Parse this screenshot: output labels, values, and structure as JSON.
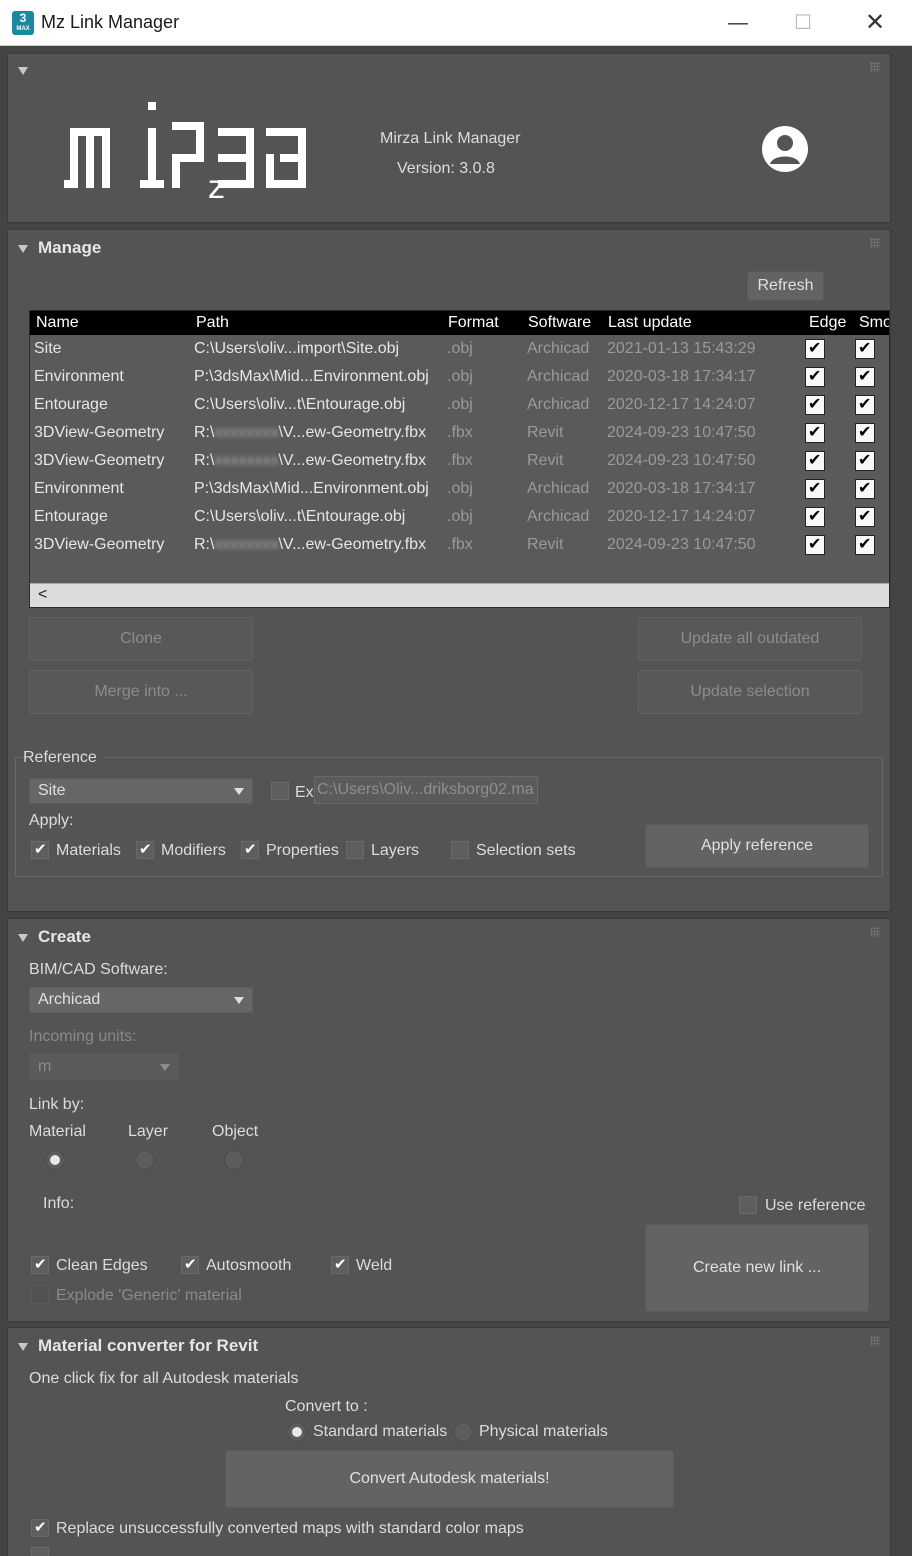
{
  "window": {
    "title": "Mz Link Manager",
    "icon_text": "3",
    "icon_sub": "MAX",
    "min": "—",
    "max": "☐",
    "close": "✕"
  },
  "header": {
    "logo_text": "mirza",
    "app_name": "Mirza Link Manager",
    "version": "Version: 3.0.8"
  },
  "manage": {
    "title": "Manage",
    "refresh": "Refresh",
    "columns": [
      "Name",
      "Path",
      "Format",
      "Software",
      "Last update",
      "Edge",
      "Smo"
    ],
    "rows": [
      {
        "name": "Site",
        "path": "C:\\Users\\oliv...import\\Site.obj",
        "format": ".obj",
        "software": "Archicad",
        "updated": "2021-01-13 15:43:29"
      },
      {
        "name": "Environment",
        "path": "P:\\3dsMax\\Mid...Environment.obj",
        "format": ".obj",
        "software": "Archicad",
        "updated": "2020-03-18 17:34:17"
      },
      {
        "name": "Entourage",
        "path": "C:\\Users\\oliv...t\\Entourage.obj",
        "format": ".obj",
        "software": "Archicad",
        "updated": "2020-12-17 14:24:07"
      },
      {
        "name": "3DView-Geometry",
        "path_a": "R:\\",
        "path_blur": "xxxxxxxx",
        "path_b": "\\V...ew-Geometry.fbx",
        "format": ".fbx",
        "software": "Revit",
        "updated": "2024-09-23 10:47:50"
      },
      {
        "name": "3DView-Geometry",
        "path_a": "R:\\",
        "path_blur": "xxxxxxxx",
        "path_b": "\\V...ew-Geometry.fbx",
        "format": ".fbx",
        "software": "Revit",
        "updated": "2024-09-23 10:47:50"
      },
      {
        "name": "Environment",
        "path": "P:\\3dsMax\\Mid...Environment.obj",
        "format": ".obj",
        "software": "Archicad",
        "updated": "2020-03-18 17:34:17"
      },
      {
        "name": "Entourage",
        "path": "C:\\Users\\oliv...t\\Entourage.obj",
        "format": ".obj",
        "software": "Archicad",
        "updated": "2020-12-17 14:24:07"
      },
      {
        "name": "3DView-Geometry",
        "path_a": "R:\\",
        "path_blur": "xxxxxxxx",
        "path_b": "\\V...ew-Geometry.fbx",
        "format": ".fbx",
        "software": "Revit",
        "updated": "2024-09-23 10:47:50"
      }
    ],
    "scroll_left": "<",
    "clone": "Clone",
    "merge_into": "Merge into ...",
    "update_all": "Update all outdated",
    "update_selection": "Update selection",
    "reference_label": "Reference",
    "reference_value": "Site",
    "ex_label": "Ex",
    "ex_path": "C:\\Users\\Oliv...driksborg02.ma",
    "apply_label": "Apply:",
    "apply_items": {
      "materials": "Materials",
      "modifiers": "Modifiers",
      "properties": "Properties",
      "layers": "Layers",
      "selection_sets": "Selection sets"
    },
    "apply_reference": "Apply reference"
  },
  "create": {
    "title": "Create",
    "software_label": "BIM/CAD Software:",
    "software_value": "Archicad",
    "units_label": "Incoming units:",
    "units_value": "m",
    "link_by_label": "Link by:",
    "link_by": {
      "material": "Material",
      "layer": "Layer",
      "object": "Object"
    },
    "info_label": "Info:",
    "use_reference": "Use reference",
    "clean_edges": "Clean Edges",
    "autosmooth": "Autosmooth",
    "weld": "Weld",
    "explode": "Explode 'Generic' material",
    "create_new_link": "Create new link ..."
  },
  "material": {
    "title": "Material converter for Revit",
    "subtitle": "One click fix for all Autodesk materials",
    "convert_to": "Convert to :",
    "standard": "Standard materials",
    "physical": "Physical materials",
    "convert_button": "Convert Autodesk materials!",
    "replace_maps": "Replace unsuccessfully converted maps with standard color maps"
  }
}
